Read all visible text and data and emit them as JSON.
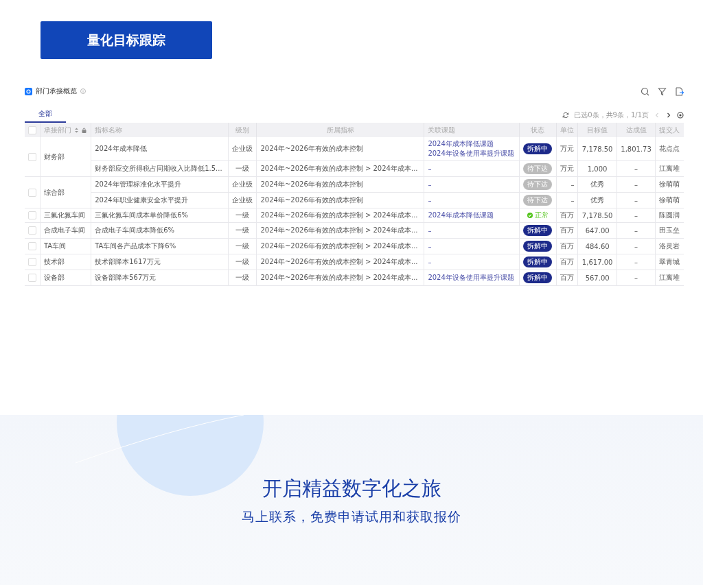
{
  "header_button": {
    "label": "量化目标跟踪"
  },
  "panel": {
    "title": "部门承接概览",
    "tabs": [
      {
        "label": "全部",
        "selected": true
      }
    ],
    "pagination": "已选0条，共9条，1/1页"
  },
  "table": {
    "select_all_checked": false,
    "columns": [
      "承接部门",
      "指标名称",
      "级别",
      "所属指标",
      "关联课题",
      "状态",
      "单位",
      "目标值",
      "达成值",
      "提交人"
    ],
    "groups": [
      {
        "department": "财务部",
        "checked": false,
        "rows": [
          {
            "name": "2024年成本降低",
            "level": "企业级",
            "parent": "2024年~2026年有效的成本控制",
            "topics": [
              "2024年成本降低课题",
              "2024年设备使用率提升课题"
            ],
            "status": {
              "kind": "splitting",
              "label": "拆解中"
            },
            "unit": "万元",
            "target": "7,178.50",
            "achieved": "1,801.73",
            "submitter": "花点点"
          },
          {
            "name": "财务部应交所得税占同期收入比降低1.5...",
            "level": "一级",
            "parent": "2024年~2026年有效的成本控制 > 2024年成本...",
            "topics": [
              "–"
            ],
            "status": {
              "kind": "pending",
              "label": "待下达"
            },
            "unit": "万元",
            "target": "1,000",
            "achieved": "–",
            "submitter": "江离堆"
          }
        ]
      },
      {
        "department": "综合部",
        "checked": false,
        "rows": [
          {
            "name": "2024年管理标准化水平提升",
            "level": "企业级",
            "parent": "2024年~2026年有效的成本控制",
            "topics": [
              "–"
            ],
            "status": {
              "kind": "pending",
              "label": "待下达"
            },
            "unit": "–",
            "target": "优秀",
            "achieved": "–",
            "submitter": "徐萌萌"
          },
          {
            "name": "2024年职业健康安全水平提升",
            "level": "企业级",
            "parent": "2024年~2026年有效的成本控制",
            "topics": [
              "–"
            ],
            "status": {
              "kind": "pending",
              "label": "待下达"
            },
            "unit": "–",
            "target": "优秀",
            "achieved": "–",
            "submitter": "徐萌萌"
          }
        ]
      },
      {
        "department": "三氟化氮车间",
        "checked": false,
        "rows": [
          {
            "name": "三氟化氮车间成本单价降低6%",
            "level": "一级",
            "parent": "2024年~2026年有效的成本控制 > 2024年成本...",
            "topics": [
              "2024年成本降低课题"
            ],
            "status": {
              "kind": "normal",
              "label": "正常"
            },
            "unit": "百万",
            "target": "7,178.50",
            "achieved": "–",
            "submitter": "陈圆润"
          }
        ]
      },
      {
        "department": "合成电子车间",
        "checked": false,
        "rows": [
          {
            "name": "合成电子车间成本降低6%",
            "level": "一级",
            "parent": "2024年~2026年有效的成本控制 > 2024年成本...",
            "topics": [
              "–"
            ],
            "status": {
              "kind": "splitting",
              "label": "拆解中"
            },
            "unit": "百万",
            "target": "647.00",
            "achieved": "–",
            "submitter": "田玉垒"
          }
        ]
      },
      {
        "department": "TA车间",
        "checked": false,
        "rows": [
          {
            "name": "TA车间各产品成本下降6%",
            "level": "一级",
            "parent": "2024年~2026年有效的成本控制 > 2024年成本...",
            "topics": [
              "–"
            ],
            "status": {
              "kind": "splitting",
              "label": "拆解中"
            },
            "unit": "百万",
            "target": "484.60",
            "achieved": "–",
            "submitter": "洛灵岩"
          }
        ]
      },
      {
        "department": "技术部",
        "checked": false,
        "rows": [
          {
            "name": "技术部降本1617万元",
            "level": "一级",
            "parent": "2024年~2026年有效的成本控制 > 2024年成本...",
            "topics": [
              "–"
            ],
            "status": {
              "kind": "splitting",
              "label": "拆解中"
            },
            "unit": "百万",
            "target": "1,617.00",
            "achieved": "–",
            "submitter": "翠青城"
          }
        ]
      },
      {
        "department": "设备部",
        "checked": false,
        "rows": [
          {
            "name": "设备部降本567万元",
            "level": "一级",
            "parent": "2024年~2026年有效的成本控制 > 2024年成本...",
            "topics": [
              "2024年设备使用率提升课题"
            ],
            "status": {
              "kind": "splitting",
              "label": "拆解中"
            },
            "unit": "百万",
            "target": "567.00",
            "achieved": "–",
            "submitter": "江离堆"
          }
        ]
      }
    ]
  },
  "banner": {
    "title": "开启精益数字化之旅",
    "subtitle": "马上联系，免费申请试用和获取报价"
  }
}
